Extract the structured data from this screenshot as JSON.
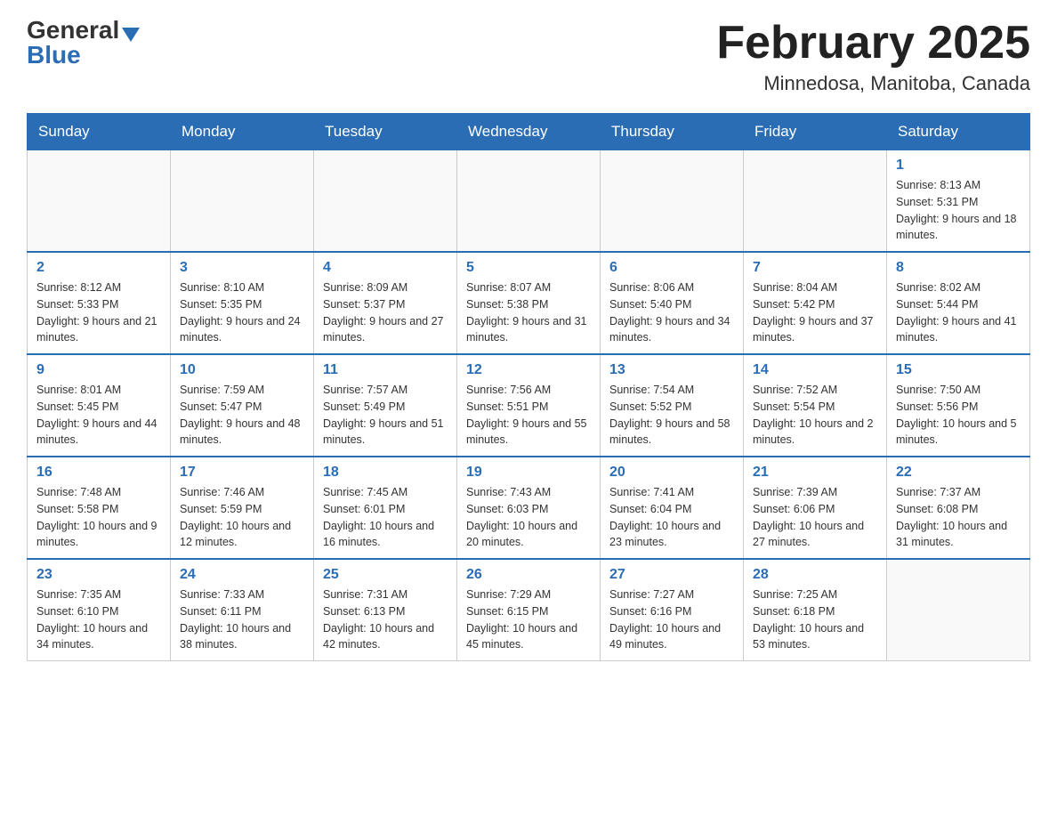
{
  "header": {
    "logo": {
      "general": "General",
      "blue": "Blue"
    },
    "title": "February 2025",
    "subtitle": "Minnedosa, Manitoba, Canada"
  },
  "weekdays": [
    "Sunday",
    "Monday",
    "Tuesday",
    "Wednesday",
    "Thursday",
    "Friday",
    "Saturday"
  ],
  "weeks": [
    [
      {
        "day": null
      },
      {
        "day": null
      },
      {
        "day": null
      },
      {
        "day": null
      },
      {
        "day": null
      },
      {
        "day": null
      },
      {
        "day": 1,
        "sunrise": "8:13 AM",
        "sunset": "5:31 PM",
        "daylight": "9 hours and 18 minutes."
      }
    ],
    [
      {
        "day": 2,
        "sunrise": "8:12 AM",
        "sunset": "5:33 PM",
        "daylight": "9 hours and 21 minutes."
      },
      {
        "day": 3,
        "sunrise": "8:10 AM",
        "sunset": "5:35 PM",
        "daylight": "9 hours and 24 minutes."
      },
      {
        "day": 4,
        "sunrise": "8:09 AM",
        "sunset": "5:37 PM",
        "daylight": "9 hours and 27 minutes."
      },
      {
        "day": 5,
        "sunrise": "8:07 AM",
        "sunset": "5:38 PM",
        "daylight": "9 hours and 31 minutes."
      },
      {
        "day": 6,
        "sunrise": "8:06 AM",
        "sunset": "5:40 PM",
        "daylight": "9 hours and 34 minutes."
      },
      {
        "day": 7,
        "sunrise": "8:04 AM",
        "sunset": "5:42 PM",
        "daylight": "9 hours and 37 minutes."
      },
      {
        "day": 8,
        "sunrise": "8:02 AM",
        "sunset": "5:44 PM",
        "daylight": "9 hours and 41 minutes."
      }
    ],
    [
      {
        "day": 9,
        "sunrise": "8:01 AM",
        "sunset": "5:45 PM",
        "daylight": "9 hours and 44 minutes."
      },
      {
        "day": 10,
        "sunrise": "7:59 AM",
        "sunset": "5:47 PM",
        "daylight": "9 hours and 48 minutes."
      },
      {
        "day": 11,
        "sunrise": "7:57 AM",
        "sunset": "5:49 PM",
        "daylight": "9 hours and 51 minutes."
      },
      {
        "day": 12,
        "sunrise": "7:56 AM",
        "sunset": "5:51 PM",
        "daylight": "9 hours and 55 minutes."
      },
      {
        "day": 13,
        "sunrise": "7:54 AM",
        "sunset": "5:52 PM",
        "daylight": "9 hours and 58 minutes."
      },
      {
        "day": 14,
        "sunrise": "7:52 AM",
        "sunset": "5:54 PM",
        "daylight": "10 hours and 2 minutes."
      },
      {
        "day": 15,
        "sunrise": "7:50 AM",
        "sunset": "5:56 PM",
        "daylight": "10 hours and 5 minutes."
      }
    ],
    [
      {
        "day": 16,
        "sunrise": "7:48 AM",
        "sunset": "5:58 PM",
        "daylight": "10 hours and 9 minutes."
      },
      {
        "day": 17,
        "sunrise": "7:46 AM",
        "sunset": "5:59 PM",
        "daylight": "10 hours and 12 minutes."
      },
      {
        "day": 18,
        "sunrise": "7:45 AM",
        "sunset": "6:01 PM",
        "daylight": "10 hours and 16 minutes."
      },
      {
        "day": 19,
        "sunrise": "7:43 AM",
        "sunset": "6:03 PM",
        "daylight": "10 hours and 20 minutes."
      },
      {
        "day": 20,
        "sunrise": "7:41 AM",
        "sunset": "6:04 PM",
        "daylight": "10 hours and 23 minutes."
      },
      {
        "day": 21,
        "sunrise": "7:39 AM",
        "sunset": "6:06 PM",
        "daylight": "10 hours and 27 minutes."
      },
      {
        "day": 22,
        "sunrise": "7:37 AM",
        "sunset": "6:08 PM",
        "daylight": "10 hours and 31 minutes."
      }
    ],
    [
      {
        "day": 23,
        "sunrise": "7:35 AM",
        "sunset": "6:10 PM",
        "daylight": "10 hours and 34 minutes."
      },
      {
        "day": 24,
        "sunrise": "7:33 AM",
        "sunset": "6:11 PM",
        "daylight": "10 hours and 38 minutes."
      },
      {
        "day": 25,
        "sunrise": "7:31 AM",
        "sunset": "6:13 PM",
        "daylight": "10 hours and 42 minutes."
      },
      {
        "day": 26,
        "sunrise": "7:29 AM",
        "sunset": "6:15 PM",
        "daylight": "10 hours and 45 minutes."
      },
      {
        "day": 27,
        "sunrise": "7:27 AM",
        "sunset": "6:16 PM",
        "daylight": "10 hours and 49 minutes."
      },
      {
        "day": 28,
        "sunrise": "7:25 AM",
        "sunset": "6:18 PM",
        "daylight": "10 hours and 53 minutes."
      },
      {
        "day": null
      }
    ]
  ],
  "labels": {
    "sunrise": "Sunrise:",
    "sunset": "Sunset:",
    "daylight": "Daylight:"
  }
}
